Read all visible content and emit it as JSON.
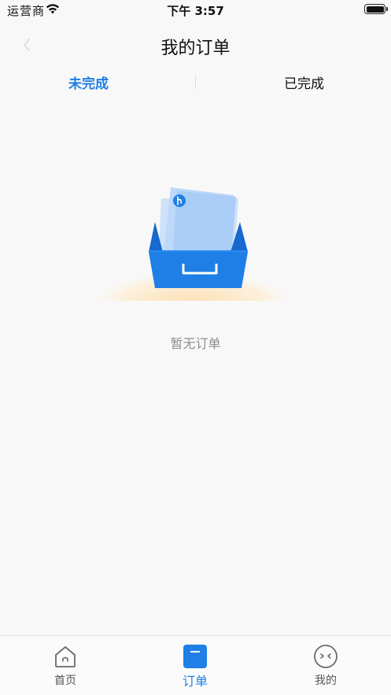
{
  "status_bar": {
    "carrier": "运营商",
    "time": "下午 3:57"
  },
  "nav": {
    "title": "我的订单"
  },
  "tabs": [
    {
      "label": "未完成",
      "active": true
    },
    {
      "label": "已完成",
      "active": false
    }
  ],
  "empty_state": {
    "message": "暂无订单"
  },
  "tab_bar": [
    {
      "label": "首页",
      "icon": "home-icon",
      "active": false
    },
    {
      "label": "订单",
      "icon": "orders-icon",
      "active": true
    },
    {
      "label": "我的",
      "icon": "profile-icon",
      "active": false
    }
  ],
  "colors": {
    "accent": "#1f7fe6",
    "background": "#f8f8f8",
    "text_secondary": "#8e8e93"
  }
}
